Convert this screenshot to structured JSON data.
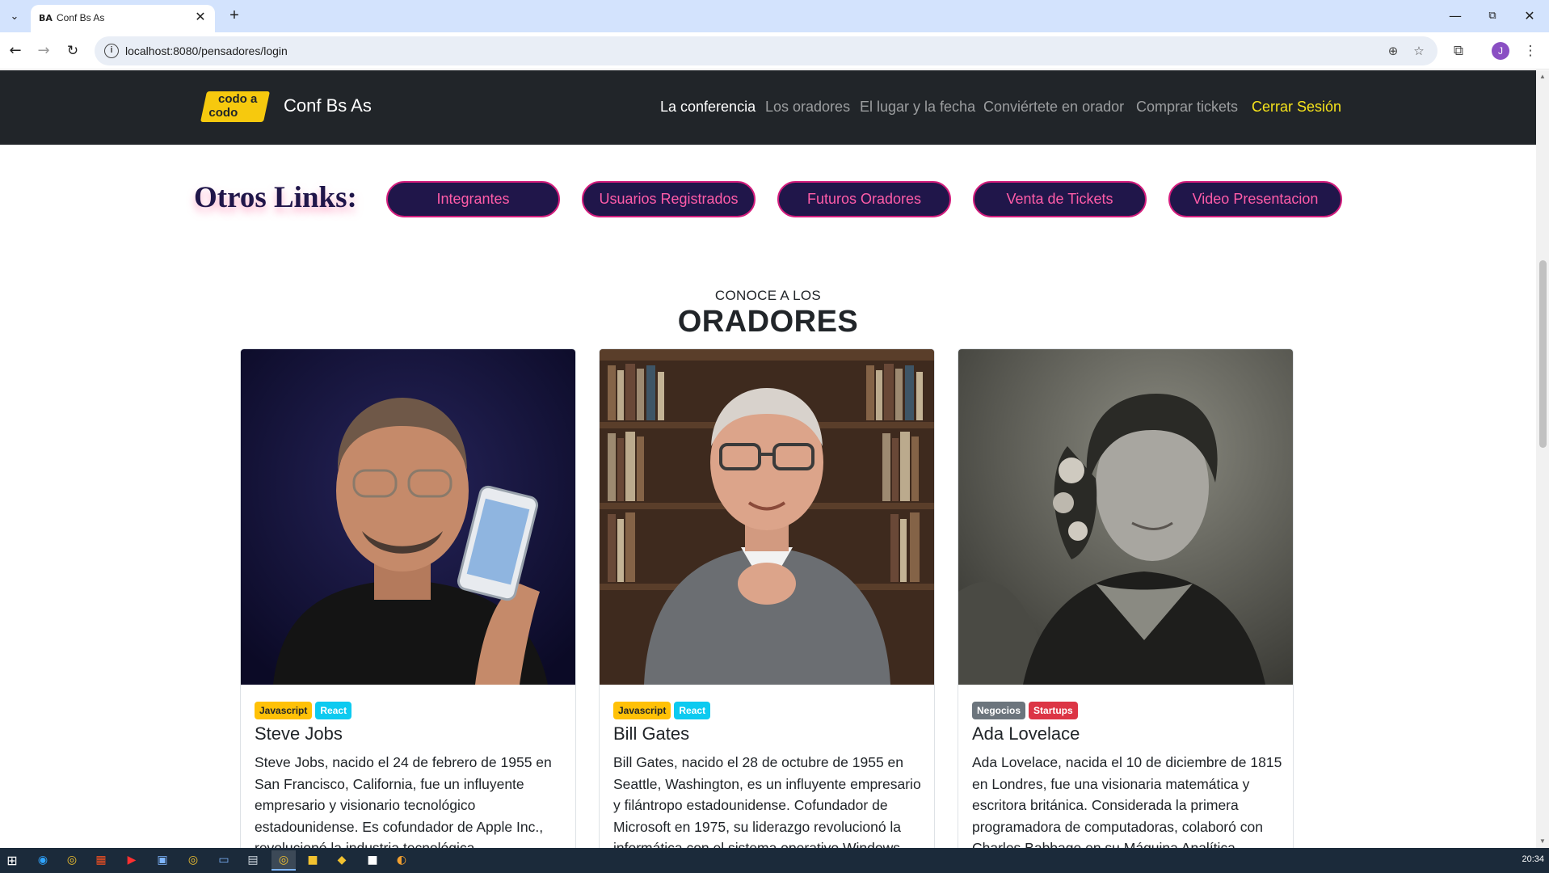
{
  "browser": {
    "tab_title": "Conf Bs As",
    "tab_favicon": "BA",
    "url": "localhost:8080/pensadores/login",
    "profile_initial": "J"
  },
  "site": {
    "brand_logo_top": "codo a",
    "brand_logo_bottom": "codo",
    "brand_name": "Conf Bs As",
    "nav": [
      {
        "label": "La conferencia"
      },
      {
        "label": "Los oradores"
      },
      {
        "label": "El lugar y la fecha"
      },
      {
        "label": "Conviértete en orador"
      },
      {
        "label": "Comprar tickets"
      },
      {
        "label": "Cerrar Sesión"
      }
    ]
  },
  "otros_links": {
    "title": "Otros Links:",
    "links": [
      {
        "label": "Integrantes"
      },
      {
        "label": "Usuarios Registrados"
      },
      {
        "label": "Futuros Oradores"
      },
      {
        "label": "Venta de Tickets"
      },
      {
        "label": "Video Presentacion"
      }
    ]
  },
  "oradores": {
    "kicker": "CONOCE A LOS",
    "title": "ORADORES",
    "cards": [
      {
        "name": "Steve Jobs",
        "badges": [
          "Javascript",
          "React"
        ],
        "text": "Steve Jobs, nacido el 24 de febrero de 1955 en San Francisco, California, fue un influyente empresario y visionario tecnológico estadounidense. Es cofundador de Apple Inc., revolucionó la industria tecnológica."
      },
      {
        "name": "Bill Gates",
        "badges": [
          "Javascript",
          "React"
        ],
        "text": "Bill Gates, nacido el 28 de octubre de 1955 en Seattle, Washington, es un influyente empresario y filántropo estadounidense. Cofundador de Microsoft en 1975, su liderazgo revolucionó la informática con el sistema operativo Windows."
      },
      {
        "name": "Ada Lovelace",
        "badges": [
          "Negocios",
          "Startups"
        ],
        "text": "Ada Lovelace, nacida el 10 de diciembre de 1815 en Londres, fue una visionaria matemática y escritora británica. Considerada la primera programadora de computadoras, colaboró con Charles Babbage en su Máquina Analítica."
      }
    ]
  },
  "taskbar": {
    "clock": "20:34"
  }
}
